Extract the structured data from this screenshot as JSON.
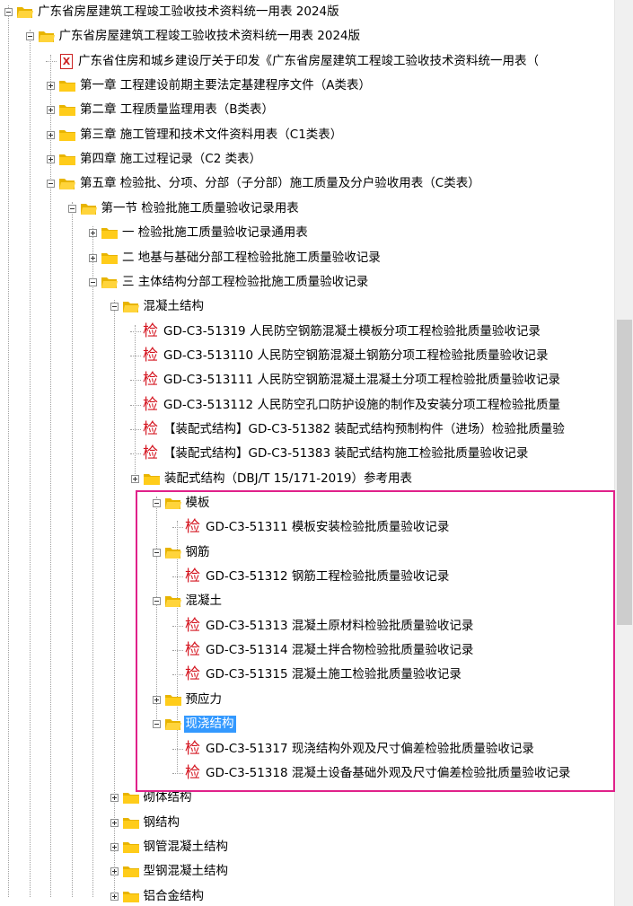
{
  "tree": {
    "nodes": [
      {
        "id": "n0",
        "label": "广东省房屋建筑工程竣工验收技术资料统一用表 2024版",
        "icon": "folder-open-icon",
        "expander": "minus",
        "level": 0
      },
      {
        "id": "n1",
        "label": "广东省房屋建筑工程竣工验收技术资料统一用表 2024版",
        "icon": "folder-open-icon",
        "expander": "minus",
        "level": 1
      },
      {
        "id": "n2",
        "label": "广东省住房和城乡建设厅关于印发《广东省房屋建筑工程竣工验收技术资料统一用表（",
        "icon": "pdf-file-icon",
        "expander": "none",
        "level": 2
      },
      {
        "id": "n3",
        "label": "第一章  工程建设前期主要法定基建程序文件（A类表）",
        "icon": "folder-icon",
        "expander": "plus",
        "level": 2
      },
      {
        "id": "n4",
        "label": "第二章  工程质量监理用表（B类表）",
        "icon": "folder-icon",
        "expander": "plus",
        "level": 2
      },
      {
        "id": "n5",
        "label": "第三章  施工管理和技术文件资料用表（C1类表）",
        "icon": "folder-icon",
        "expander": "plus",
        "level": 2
      },
      {
        "id": "n6",
        "label": "第四章  施工过程记录（C2 类表）",
        "icon": "folder-icon",
        "expander": "plus",
        "level": 2
      },
      {
        "id": "n7",
        "label": "第五章  检验批、分项、分部（子分部）施工质量及分户验收用表（C类表）",
        "icon": "folder-open-icon",
        "expander": "minus",
        "level": 2
      },
      {
        "id": "n8",
        "label": "第一节 检验批施工质量验收记录用表",
        "icon": "folder-open-icon",
        "expander": "minus",
        "level": 3
      },
      {
        "id": "n9",
        "label": "一 检验批施工质量验收记录通用表",
        "icon": "folder-icon",
        "expander": "plus",
        "level": 4
      },
      {
        "id": "n10",
        "label": "二 地基与基础分部工程检验批施工质量验收记录",
        "icon": "folder-icon",
        "expander": "plus",
        "level": 4
      },
      {
        "id": "n11",
        "label": "三 主体结构分部工程检验批施工质量验收记录",
        "icon": "folder-open-icon",
        "expander": "minus",
        "level": 4
      },
      {
        "id": "n12",
        "label": "混凝土结构",
        "icon": "folder-open-icon",
        "expander": "minus",
        "level": 5
      },
      {
        "id": "n13",
        "label": "GD-C3-51319 人民防空钢筋混凝土模板分项工程检验批质量验收记录",
        "icon": "inspection-form-icon",
        "expander": "none",
        "level": 6
      },
      {
        "id": "n14",
        "label": "GD-C3-513110 人民防空钢筋混凝土钢筋分项工程检验批质量验收记录",
        "icon": "inspection-form-icon",
        "expander": "none",
        "level": 6
      },
      {
        "id": "n15",
        "label": "GD-C3-513111 人民防空钢筋混凝土混凝土分项工程检验批质量验收记录",
        "icon": "inspection-form-icon",
        "expander": "none",
        "level": 6
      },
      {
        "id": "n16",
        "label": "GD-C3-513112 人民防空孔口防护设施的制作及安装分项工程检验批质量",
        "icon": "inspection-form-icon",
        "expander": "none",
        "level": 6
      },
      {
        "id": "n17",
        "label": "【装配式结构】GD-C3-51382 装配式结构预制构件（进场）检验批质量验",
        "icon": "inspection-form-icon",
        "expander": "none",
        "level": 6
      },
      {
        "id": "n18",
        "label": "【装配式结构】GD-C3-51383 装配式结构施工检验批质量验收记录",
        "icon": "inspection-form-icon",
        "expander": "none",
        "level": 6
      },
      {
        "id": "n19",
        "label": "装配式结构（DBJ/T 15/171-2019）参考用表",
        "icon": "folder-icon",
        "expander": "plus",
        "level": 6
      },
      {
        "id": "n20",
        "label": "模板",
        "icon": "folder-open-icon",
        "expander": "minus",
        "level": 7
      },
      {
        "id": "n21",
        "label": "GD-C3-51311 模板安装检验批质量验收记录",
        "icon": "inspection-form-icon",
        "expander": "none",
        "level": 8
      },
      {
        "id": "n22",
        "label": "钢筋",
        "icon": "folder-open-icon",
        "expander": "minus",
        "level": 7
      },
      {
        "id": "n23",
        "label": "GD-C3-51312 钢筋工程检验批质量验收记录",
        "icon": "inspection-form-icon",
        "expander": "none",
        "level": 8
      },
      {
        "id": "n24",
        "label": "混凝土",
        "icon": "folder-open-icon",
        "expander": "minus",
        "level": 7
      },
      {
        "id": "n25",
        "label": "GD-C3-51313 混凝土原材料检验批质量验收记录",
        "icon": "inspection-form-icon",
        "expander": "none",
        "level": 8
      },
      {
        "id": "n26",
        "label": "GD-C3-51314 混凝土拌合物检验批质量验收记录",
        "icon": "inspection-form-icon",
        "expander": "none",
        "level": 8
      },
      {
        "id": "n27",
        "label": "GD-C3-51315 混凝土施工检验批质量验收记录",
        "icon": "inspection-form-icon",
        "expander": "none",
        "level": 8
      },
      {
        "id": "n28",
        "label": "预应力",
        "icon": "folder-icon",
        "expander": "plus",
        "level": 7
      },
      {
        "id": "n29",
        "label": "现浇结构",
        "icon": "folder-open-icon",
        "expander": "minus",
        "level": 7,
        "selected": true
      },
      {
        "id": "n30",
        "label": "GD-C3-51317 现浇结构外观及尺寸偏差检验批质量验收记录",
        "icon": "inspection-form-icon",
        "expander": "none",
        "level": 8
      },
      {
        "id": "n31",
        "label": "GD-C3-51318 混凝土设备基础外观及尺寸偏差检验批质量验收记录",
        "icon": "inspection-form-icon",
        "expander": "none",
        "level": 8
      },
      {
        "id": "n32",
        "label": "砌体结构",
        "icon": "folder-icon",
        "expander": "plus",
        "level": 5
      },
      {
        "id": "n33",
        "label": "钢结构",
        "icon": "folder-icon",
        "expander": "plus",
        "level": 5
      },
      {
        "id": "n34",
        "label": "钢管混凝土结构",
        "icon": "folder-icon",
        "expander": "plus",
        "level": 5
      },
      {
        "id": "n35",
        "label": "型钢混凝土结构",
        "icon": "folder-icon",
        "expander": "plus",
        "level": 5
      },
      {
        "id": "n36",
        "label": "铝合金结构",
        "icon": "folder-icon",
        "expander": "plus",
        "level": 5
      }
    ]
  },
  "inspection_icon_glyph": "检",
  "pdf_icon_glyph": "X",
  "colors": {
    "folder": "#f5c518",
    "folder_dark": "#e0a800",
    "selection": "#3399ff",
    "highlight_box": "#e0218a",
    "inspection_icon": "#d4141f"
  }
}
